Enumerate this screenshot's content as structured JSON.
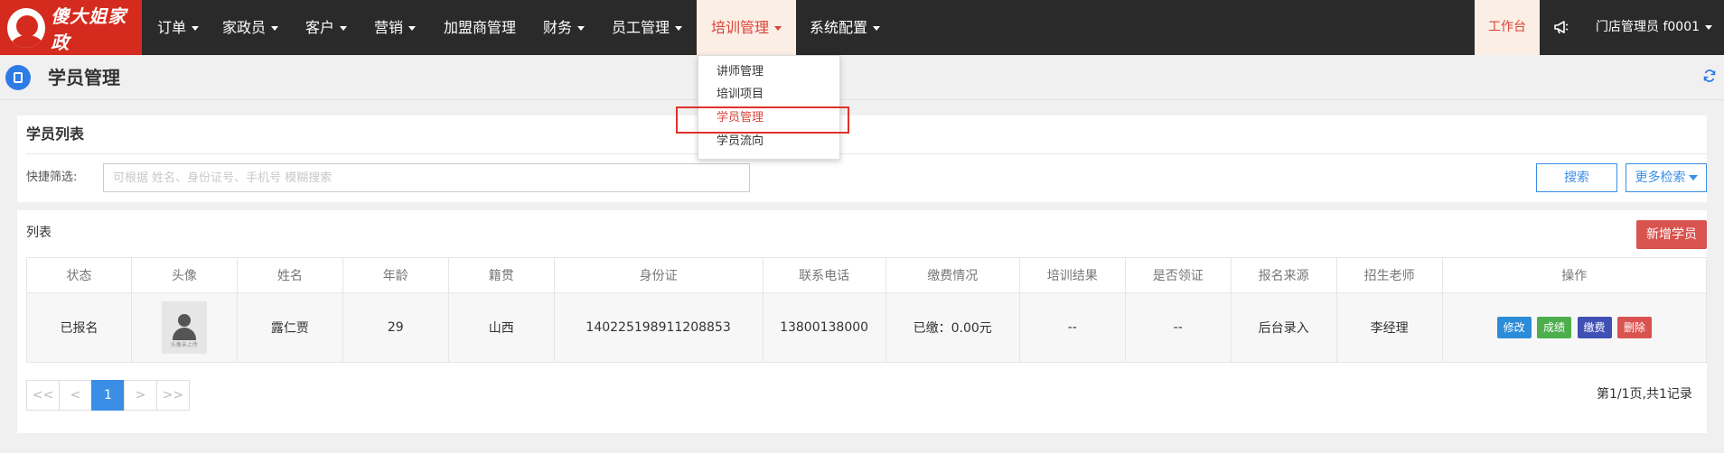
{
  "brand": {
    "name": "傻大姐家政"
  },
  "nav": {
    "items": [
      {
        "label": "订单",
        "has_caret": true
      },
      {
        "label": "家政员",
        "has_caret": true
      },
      {
        "label": "客户",
        "has_caret": true
      },
      {
        "label": "营销",
        "has_caret": true
      },
      {
        "label": "加盟商管理",
        "has_caret": false
      },
      {
        "label": "财务",
        "has_caret": true
      },
      {
        "label": "员工管理",
        "has_caret": true
      },
      {
        "label": "培训管理",
        "has_caret": true,
        "active": true
      },
      {
        "label": "系统配置",
        "has_caret": true
      }
    ],
    "workbench": "工作台",
    "user": "门店管理员 f0001"
  },
  "dropdown": {
    "items": [
      {
        "label": "讲师管理"
      },
      {
        "label": "培训项目"
      },
      {
        "label": "学员管理",
        "active": true
      },
      {
        "label": "学员流向"
      }
    ]
  },
  "page": {
    "title": "学员管理"
  },
  "filter": {
    "section_title": "学员列表",
    "label": "快捷筛选:",
    "placeholder": "可根据 姓名、身份证号、手机号 模糊搜索",
    "value": "",
    "search_button": "搜索",
    "more_button": "更多检索"
  },
  "list": {
    "label": "列表",
    "new_button": "新增学员",
    "columns": [
      "状态",
      "头像",
      "姓名",
      "年龄",
      "籍贯",
      "身份证",
      "联系电话",
      "缴费情况",
      "培训结果",
      "是否领证",
      "报名来源",
      "招生老师",
      "操作"
    ],
    "rows": [
      {
        "status": "已报名",
        "avatar_caption": "头像未上传",
        "name": "露仁贾",
        "age": "29",
        "origin": "山西",
        "id_card": "140225198911208853",
        "phone": "13800138000",
        "payment": "已缴：0.00元",
        "training_result": "--",
        "certificate": "--",
        "source": "后台录入",
        "teacher": "李经理",
        "actions": [
          "修改",
          "成绩",
          "缴费",
          "删除"
        ]
      }
    ]
  },
  "pagination": {
    "first": "<<",
    "prev": "<",
    "current": "1",
    "next": ">",
    "last": ">>",
    "info": "第1/1页,共1记录"
  },
  "colors": {
    "brand_red": "#d52b1e",
    "nav_bg": "#2a2a2a",
    "active_text": "#d9443a",
    "primary_blue": "#3a8ee6",
    "danger": "#d9534f"
  }
}
